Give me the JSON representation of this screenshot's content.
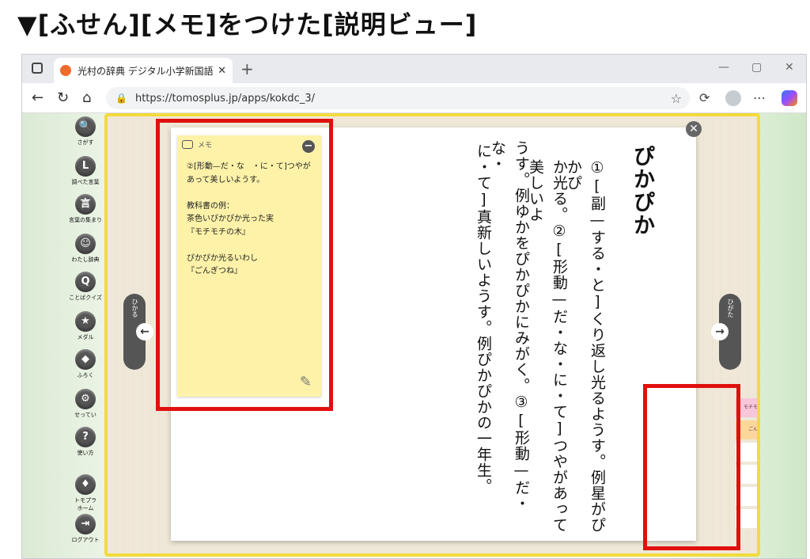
{
  "caption": "▼[ふせん][メモ]をつけた[説明ビュー]",
  "browser": {
    "tab_title": "光村の辞典 デジタル小学新国語辞典",
    "url": "https://tomosplus.jp/apps/kokdc_3/"
  },
  "sidebar": [
    {
      "label": "さがす",
      "icon": "search-icon",
      "glyph": "🔍"
    },
    {
      "label": "調べた言葉",
      "icon": "history-icon",
      "glyph": "L"
    },
    {
      "label": "言葉の集まり",
      "icon": "word-group-icon",
      "glyph": "言"
    },
    {
      "label": "わたし辞典",
      "icon": "my-dictionary-icon",
      "glyph": "☺"
    },
    {
      "label": "ことばクイズ",
      "icon": "quiz-icon",
      "glyph": "Q"
    },
    {
      "label": "メダル",
      "icon": "medal-icon",
      "glyph": "★"
    },
    {
      "label": "ふろく",
      "icon": "appendix-icon",
      "glyph": "◆"
    },
    {
      "label": "せってい",
      "icon": "gear-icon",
      "glyph": "⚙"
    },
    {
      "label": "使い方",
      "icon": "help-icon",
      "glyph": "?"
    },
    {
      "label": "トモプラ\nホーム",
      "icon": "home-icon",
      "glyph": "♦"
    },
    {
      "label": "ログアウト",
      "icon": "logout-icon",
      "glyph": "⇥"
    }
  ],
  "nav": {
    "prev_label": "ひかる",
    "next_label": "ひがた"
  },
  "memo": {
    "header": "メモ",
    "body": "②[形動—だ・な　・に・て]つやがあって美しいようす。\n\n教科書の例：\n茶色いぴかぴか光った実\n『モチモチの木』\n\nぴかぴか光るいわし\n『ごんぎつね』"
  },
  "entry": {
    "headword": "ぴかぴか",
    "line1": "①[副—する・と]くり返し光るようす。例星がぴかぴ",
    "line2": "か光る。②[形動—だ・な・に・て]つやがあって美しいよ",
    "line3": "うす。例ゆかをぴかぴかにみがく。③[形動—だ・な・",
    "line4": "に・て]真新しいようす。例ぴかぴかの一年生。"
  },
  "sticky_tabs": [
    {
      "label": "モチモチの木",
      "color": "#f7c6d9"
    },
    {
      "label": "ごんぎつね",
      "color": "#fbd79a"
    },
    {
      "label": "",
      "color": "#cfe8b3"
    },
    {
      "label": "",
      "color": "#bfe3ef"
    },
    {
      "label": "",
      "color": "#cbc8ef"
    },
    {
      "label": "",
      "color": "#d6d6d6"
    }
  ]
}
